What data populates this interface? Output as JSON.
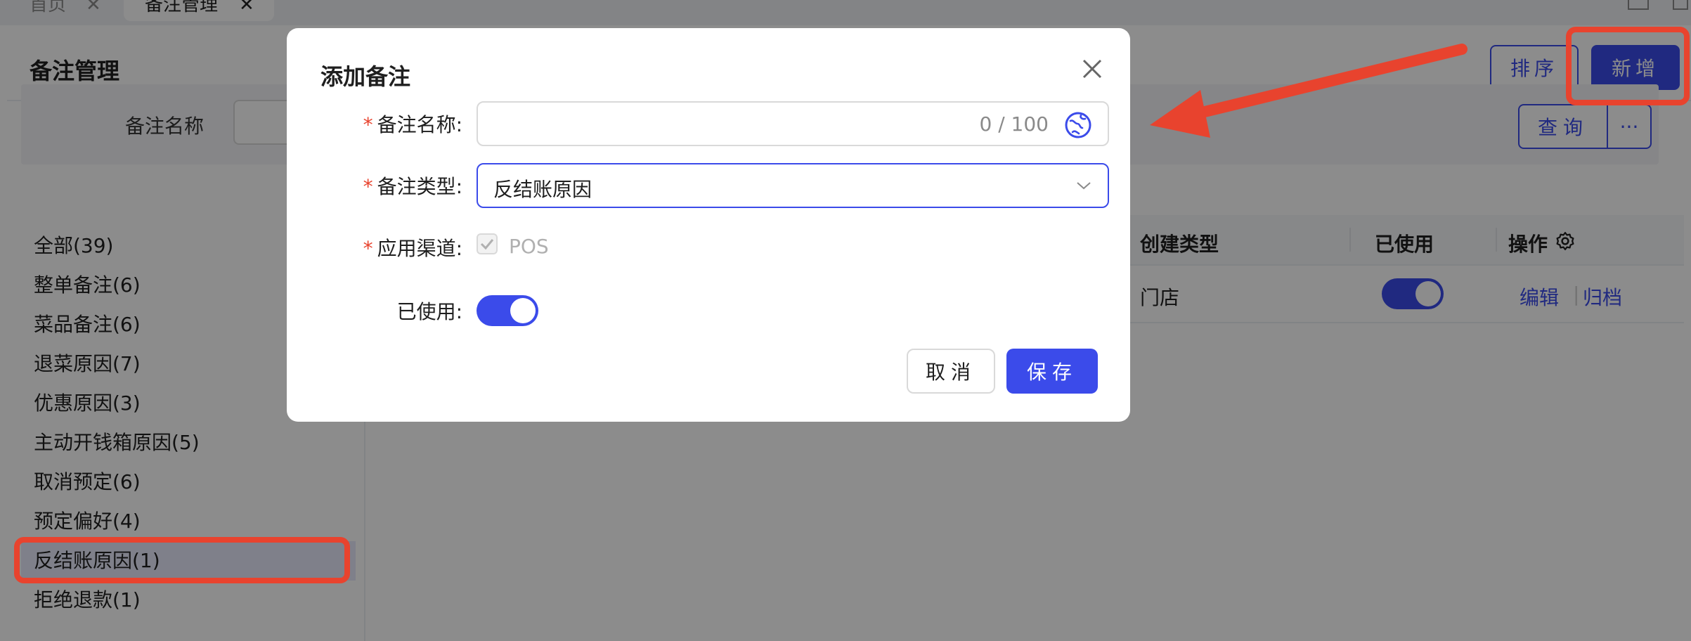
{
  "tabs": [
    {
      "label": "首页",
      "close": "✕"
    },
    {
      "label": "备注管理",
      "close": "✕"
    }
  ],
  "page": {
    "title": "备注管理",
    "sort_label": "排序",
    "add_label": "新增"
  },
  "filter": {
    "name_label": "备注名称",
    "name_value": "",
    "query_label": "查询",
    "more_label": "···"
  },
  "categories": [
    {
      "label": "全部(39)"
    },
    {
      "label": "整单备注(6)"
    },
    {
      "label": "菜品备注(6)"
    },
    {
      "label": "退菜原因(7)"
    },
    {
      "label": "优惠原因(3)"
    },
    {
      "label": "主动开钱箱原因(5)"
    },
    {
      "label": "取消预定(6)"
    },
    {
      "label": "预定偏好(4)"
    },
    {
      "label": "反结账原因(1)"
    },
    {
      "label": "拒绝退款(1)"
    }
  ],
  "selected_category": "反结账原因(1)",
  "table": {
    "columns": [
      "创建类型",
      "已使用",
      "操作"
    ],
    "rows": [
      {
        "create_type": "门店",
        "used": true,
        "edit_label": "编辑",
        "archive_label": "归档"
      }
    ]
  },
  "modal": {
    "title": "添加备注",
    "close_icon": "close-icon",
    "name_label": "备注名称:",
    "name_value": "",
    "name_counter": "0 / 100",
    "type_label": "备注类型:",
    "type_value": "反结账原因",
    "channel_label": "应用渠道:",
    "channel_option": "POS",
    "channel_checked": true,
    "used_label": "已使用:",
    "used_on": true,
    "required_mark": "*",
    "cancel_label": "取消",
    "save_label": "保存"
  },
  "colors": {
    "primary": "#3b4bea",
    "annotation": "#e8432e",
    "overlay": "rgba(0,0,0,0.45)"
  }
}
